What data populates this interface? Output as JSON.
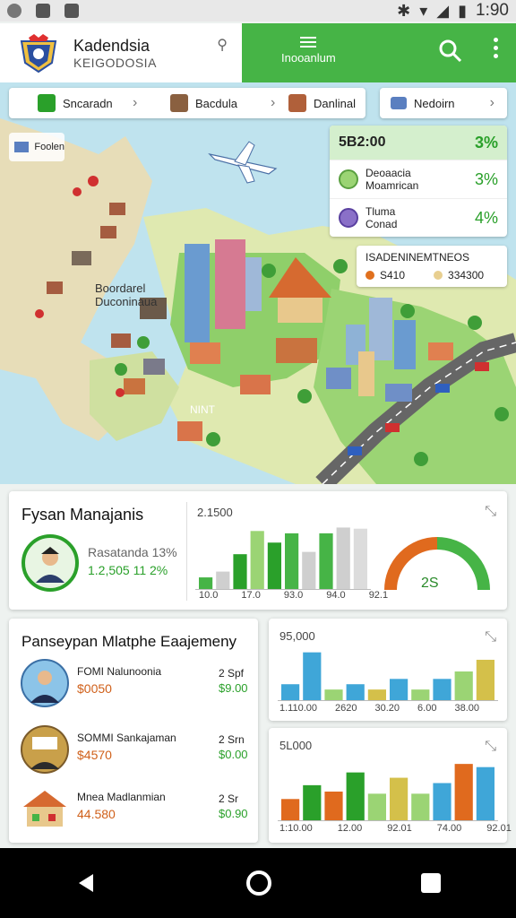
{
  "status_bar": {
    "time": "1:90"
  },
  "app_bar": {
    "title": "Kadendsia",
    "subtitle": "KEIGODOSIA",
    "menu_label": "Inooanlum",
    "accent": "#46b446"
  },
  "tabs": [
    {
      "label": "Sncaradn",
      "icon": "money-icon"
    },
    {
      "label": "Bacdula",
      "icon": "bag-icon"
    },
    {
      "label": "Danlinal",
      "icon": "box-icon"
    }
  ],
  "tab_extra": {
    "label": "Nedoirn"
  },
  "map": {
    "legend_chip": "Foolen",
    "region_label_1": "Boordarel",
    "region_label_2": "Duconinaua",
    "water_label": "NINT"
  },
  "stats_card": {
    "header_value": "5B2:00",
    "header_pct": "3%",
    "rows": [
      {
        "line1": "Deoaacia",
        "line2": "Moamrican",
        "pct": "3%"
      },
      {
        "line1": "Tluma",
        "line2": "Conad",
        "pct": "4%"
      }
    ]
  },
  "legend_card": {
    "title": "ISADENINEMTNEOS",
    "items": [
      {
        "color": "#e0701e",
        "label": "S410"
      },
      {
        "color": "#e8cf90",
        "label": "334300"
      }
    ]
  },
  "card1": {
    "title": "Fysan Manajanis",
    "person_label": "Rasatanda 13%",
    "person_value": "1.2,505 11  2%",
    "chart_value": "2.1500",
    "gauge_value": "2S",
    "chart_data": {
      "type": "bar",
      "categories": [
        "10.0",
        "17.0",
        "93.0",
        "94.0",
        "92.1"
      ],
      "series": [
        {
          "values": [
            1,
            1.5,
            3,
            5,
            4,
            4.8,
            3.2,
            4.8,
            5.3,
            5.2
          ]
        }
      ]
    }
  },
  "card2": {
    "title": "Panseypan Mlatphe Eaajemeny",
    "items": [
      {
        "name": "FOMI Nalunoonia",
        "value1": "$0050",
        "side_label": "2 Spf",
        "side_value": "$9.00"
      },
      {
        "name": "SOMMI Sankajaman",
        "value1": "$4570",
        "side_label": "2 Srn",
        "side_value": "$0.00"
      },
      {
        "name": "Mnea Madlanmian",
        "value1": "44.580",
        "side_label": "2 Sr",
        "side_value": "$0.90"
      }
    ]
  },
  "card3": {
    "top_value": "95,000",
    "chart_data": {
      "type": "bar",
      "categories": [
        "1.110.00",
        "2620",
        "30.20",
        "6.00",
        "38.00"
      ],
      "series": [
        {
          "values": [
            1.5,
            4.5,
            1,
            1.5,
            1,
            2,
            1,
            2,
            2.7,
            3.8
          ]
        }
      ]
    }
  },
  "card4": {
    "top_value": "5L000",
    "chart_data": {
      "type": "bar",
      "categories": [
        "1:10.00",
        "12.00",
        "92.01",
        "74.00",
        "92.01"
      ],
      "series": [
        {
          "values": [
            2,
            3.3,
            2.7,
            4.5,
            2.5,
            4,
            2.5,
            3.5,
            5.3,
            5
          ]
        }
      ]
    }
  }
}
